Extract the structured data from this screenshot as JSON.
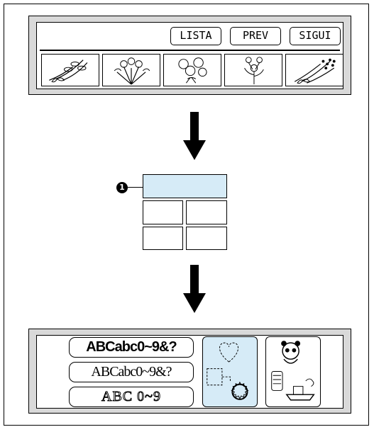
{
  "top_screen": {
    "buttons": {
      "list": "LISTA",
      "prev": "PREV",
      "next": "SIGUI"
    },
    "patterns": [
      {
        "icon": "flower-bouquet-1-icon"
      },
      {
        "icon": "flower-bouquet-2-icon"
      },
      {
        "icon": "flower-bouquet-3-icon"
      },
      {
        "icon": "flower-bouquet-4-icon"
      },
      {
        "icon": "flower-bouquet-5-icon"
      }
    ]
  },
  "layout_grid": {
    "callout_number": "1",
    "highlight_color": "#d6ebf7"
  },
  "bottom_screen": {
    "font_buttons": [
      {
        "label": "ABCabc0~9&?",
        "style": "gothic"
      },
      {
        "label": "ABCabc0~9&?",
        "style": "serif"
      },
      {
        "label": "ABC  0~9",
        "style": "outline"
      }
    ],
    "frame_button_icon": "frame-shapes-icon",
    "motif_button_icon": "motif-characters-icon"
  },
  "colors": {
    "screen_bg": "#d9d9d9",
    "highlight": "#d6ebf7"
  }
}
